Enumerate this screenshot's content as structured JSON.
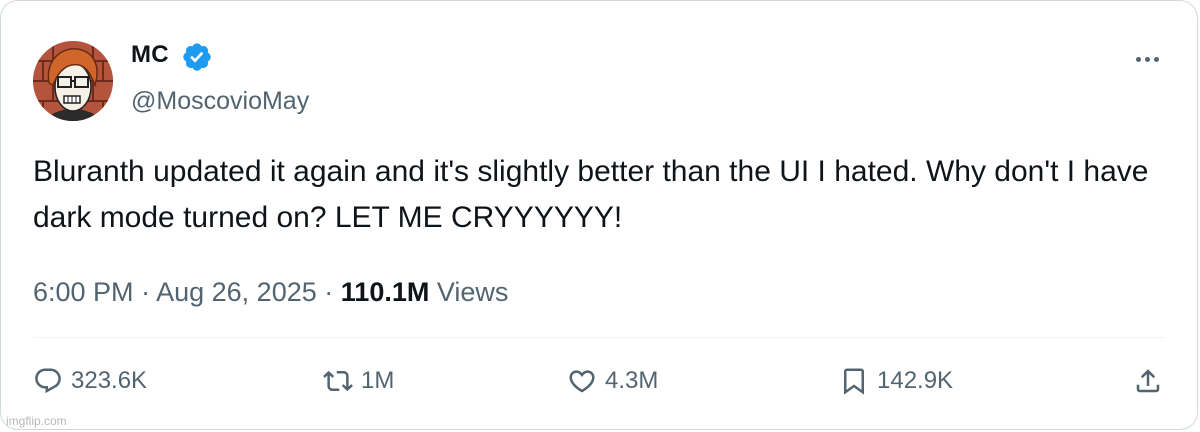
{
  "tweet": {
    "author": {
      "name": "MC",
      "handle": "@MoscovioMay",
      "verified": true
    },
    "text": "Bluranth updated it again and it's slightly better than the UI I hated. Why don't I have dark mode turned on? LET ME CRYYYYYY!",
    "time": "6:00 PM",
    "date": "Aug 26, 2025",
    "separator": "·",
    "views_count": "110.1M",
    "views_label": "Views",
    "actions": {
      "replies": "323.6K",
      "reposts": "1M",
      "likes": "4.3M",
      "bookmarks": "142.9K"
    }
  },
  "watermark": "imgflip.com",
  "colors": {
    "verified": "#1d9bf0",
    "text": "#0f1419",
    "secondary": "#536471",
    "border": "#cfd9de"
  }
}
